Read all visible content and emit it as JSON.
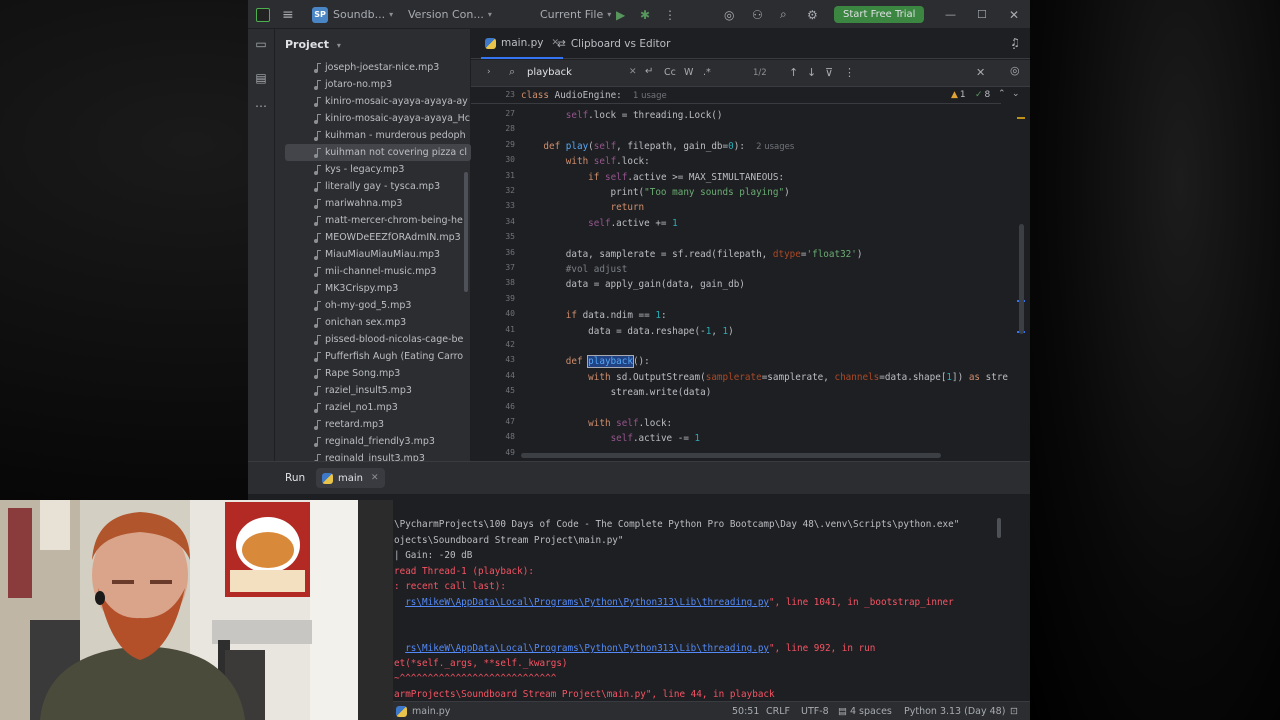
{
  "titlebar": {
    "project_badge": "SP",
    "project_name": "Soundb...",
    "vcs": "Version Con...",
    "run_config": "Current File",
    "trial_button": "Start Free Trial"
  },
  "project_panel": {
    "title": "Project",
    "files": [
      "joseph-joestar-nice.mp3",
      "jotaro-no.mp3",
      "kiniro-mosaic-ayaya-ayaya-ay",
      "kiniro-mosaic-ayaya-ayaya_Hc",
      "kuihman - murderous pedoph",
      "kuihman not covering pizza cl",
      "kys - legacy.mp3",
      "literally gay - tysca.mp3",
      "mariwahna.mp3",
      "matt-mercer-chrom-being-he",
      "MEOWDeEEZfORAdmIN.mp3",
      "MiauMiauMiauMiau.mp3",
      "mii-channel-music.mp3",
      "MK3Crispy.mp3",
      "oh-my-god_5.mp3",
      "onichan sex.mp3",
      "pissed-blood-nicolas-cage-be",
      "Pufferfish Augh (Eating Carro",
      "Rape Song.mp3",
      "raziel_insult5.mp3",
      "raziel_no1.mp3",
      "reetard.mp3",
      "reginald_friendly3.mp3",
      "reginald_insult3.mp3"
    ],
    "selected_index": 5
  },
  "editor": {
    "tabs": [
      {
        "label": "main.py"
      },
      {
        "label": "Clipboard vs Editor"
      }
    ],
    "find": {
      "query": "playback",
      "case_label": "Cc",
      "word_label": "W",
      "regex_label": ".*",
      "match_count": "1/2"
    },
    "inspections": {
      "warnings": "1",
      "weak_warnings": "8"
    },
    "sticky": {
      "line": "23",
      "usages": "1 usage"
    },
    "line_numbers": [
      "27",
      "28",
      "29",
      "30",
      "31",
      "32",
      "33",
      "34",
      "35",
      "36",
      "37",
      "38",
      "39",
      "40",
      "41",
      "42",
      "43",
      "44",
      "45",
      "46",
      "47",
      "48",
      "49"
    ],
    "code": {
      "sticky_class": "AudioEngine",
      "l27_rest": ".lock = threading.Lock()",
      "play_name": "play",
      "play_params": ", filepath, gain_db=",
      "play_default": "0",
      "play_hint": "2 usages",
      "l30_rest": ".lock:",
      "l31_mid": ".active >= MAX_SIMULTANEOUS:",
      "l32_str": "\"Too many sounds playing\"",
      "l34_rest": ".active += ",
      "l36_a": "data, samplerate = sf.read(filepath, ",
      "l36_kw": "dtype",
      "l36_str": "'float32'",
      "l37": "#vol adjust",
      "l38": "data = apply_gain(data, gain_db)",
      "l40_a": "if",
      "l40_b": " data.ndim == ",
      "l41_a": "data = data.reshape(-",
      "l41_b": ", ",
      "l43_name": "playback",
      "l44_a": " sd.OutputStream(",
      "l44_kw1": "samplerate",
      "l44_b": "=samplerate, ",
      "l44_kw2": "channels",
      "l44_c": "=data.shape[",
      "l44_d": "]) ",
      "l44_e": " stre",
      "l45": "stream.write(data)",
      "l47_rest": ".lock:",
      "l48_rest": ".active -= ",
      "one": "1",
      "zero": "0"
    }
  },
  "run_panel": {
    "title": "Run",
    "tab": "main",
    "lines": [
      {
        "text": "\\PycharmProjects\\100 Days of Code - The Complete Python Pro Bootcamp\\Day 48\\.venv\\Scripts\\python.exe\"",
        "kind": "plain"
      },
      {
        "text": "ojects\\Soundboard Stream Project\\main.py\"",
        "kind": "plain"
      },
      {
        "text": "| Gain: -20 dB",
        "kind": "plain"
      },
      {
        "text": "read Thread-1 (playback):",
        "kind": "err"
      },
      {
        "text": ": recent call last):",
        "kind": "err"
      },
      {
        "link": "rs\\MikeW\\AppData\\Local\\Programs\\Python\\Python313\\Lib\\threading.py",
        "tail": "\", line 1041, in _bootstrap_inner"
      },
      {
        "link": "rs\\MikeW\\AppData\\Local\\Programs\\Python\\Python313\\Lib\\threading.py",
        "tail": "\", line 992, in run"
      },
      {
        "text": "et(*self._args, **self._kwargs)",
        "kind": "err"
      },
      {
        "text": "~^^^^^^^^^^^^^^^^^^^^^^^^^^^^",
        "kind": "err"
      },
      {
        "text": "armProjects\\Soundboard Stream Project\\main.py\", line 44, in playback",
        "kind": "err"
      }
    ]
  },
  "statusbar": {
    "file": "main.py",
    "position": "50:51",
    "line_sep": "CRLF",
    "encoding": "UTF-8",
    "indent": "4 spaces",
    "interpreter": "Python 3.13 (Day 48)"
  },
  "colors": {
    "accent": "#3574f0",
    "trial": "#3b8641",
    "error": "#f75464",
    "link": "#548af7"
  }
}
